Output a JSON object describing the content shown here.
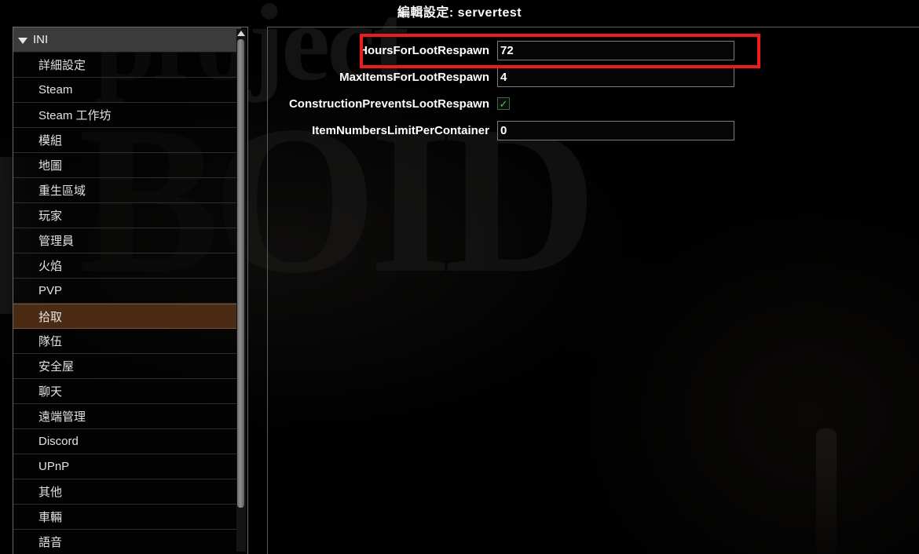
{
  "window": {
    "title": "編輯設定: servertest"
  },
  "background": {
    "word_top": "project",
    "word_main": "BOID"
  },
  "sidebar": {
    "header": {
      "label": "INI",
      "caret_icon": "chevron-down-icon",
      "expanded": true
    },
    "scrollbar": {
      "up_arrow_icon": "scroll-up-arrow-icon"
    },
    "items": [
      {
        "label": "詳細設定",
        "selected": false
      },
      {
        "label": "Steam",
        "selected": false
      },
      {
        "label": "Steam 工作坊",
        "selected": false
      },
      {
        "label": "模組",
        "selected": false
      },
      {
        "label": "地圖",
        "selected": false
      },
      {
        "label": "重生區域",
        "selected": false
      },
      {
        "label": "玩家",
        "selected": false
      },
      {
        "label": "管理員",
        "selected": false
      },
      {
        "label": "火焰",
        "selected": false
      },
      {
        "label": "PVP",
        "selected": false
      },
      {
        "label": "拾取",
        "selected": true
      },
      {
        "label": "隊伍",
        "selected": false
      },
      {
        "label": "安全屋",
        "selected": false
      },
      {
        "label": "聊天",
        "selected": false
      },
      {
        "label": "遠端管理",
        "selected": false
      },
      {
        "label": "Discord",
        "selected": false
      },
      {
        "label": "UPnP",
        "selected": false
      },
      {
        "label": "其他",
        "selected": false
      },
      {
        "label": "車輛",
        "selected": false
      },
      {
        "label": "語音",
        "selected": false
      }
    ]
  },
  "settings": {
    "rows": [
      {
        "label": "HoursForLootRespawn",
        "type": "text",
        "value": "72",
        "highlighted": true
      },
      {
        "label": "MaxItemsForLootRespawn",
        "type": "text",
        "value": "4",
        "highlighted": false
      },
      {
        "label": "ConstructionPreventsLootRespawn",
        "type": "checkbox",
        "checked": true,
        "check_glyph": "✓",
        "highlighted": false
      },
      {
        "label": "ItemNumbersLimitPerContainer",
        "type": "text",
        "value": "0",
        "highlighted": false
      }
    ]
  },
  "annotation": {
    "highlight_color": "#ec1c1c",
    "target": "HoursForLootRespawn"
  },
  "colors": {
    "selection_brown": "#4c2b14",
    "selection_border": "#7a5232",
    "panel_border": "#5c5c5c",
    "header_grey": "#3b3b3b",
    "checkbox_green": "#59c45b",
    "annotation_red": "#ec1c1c"
  }
}
